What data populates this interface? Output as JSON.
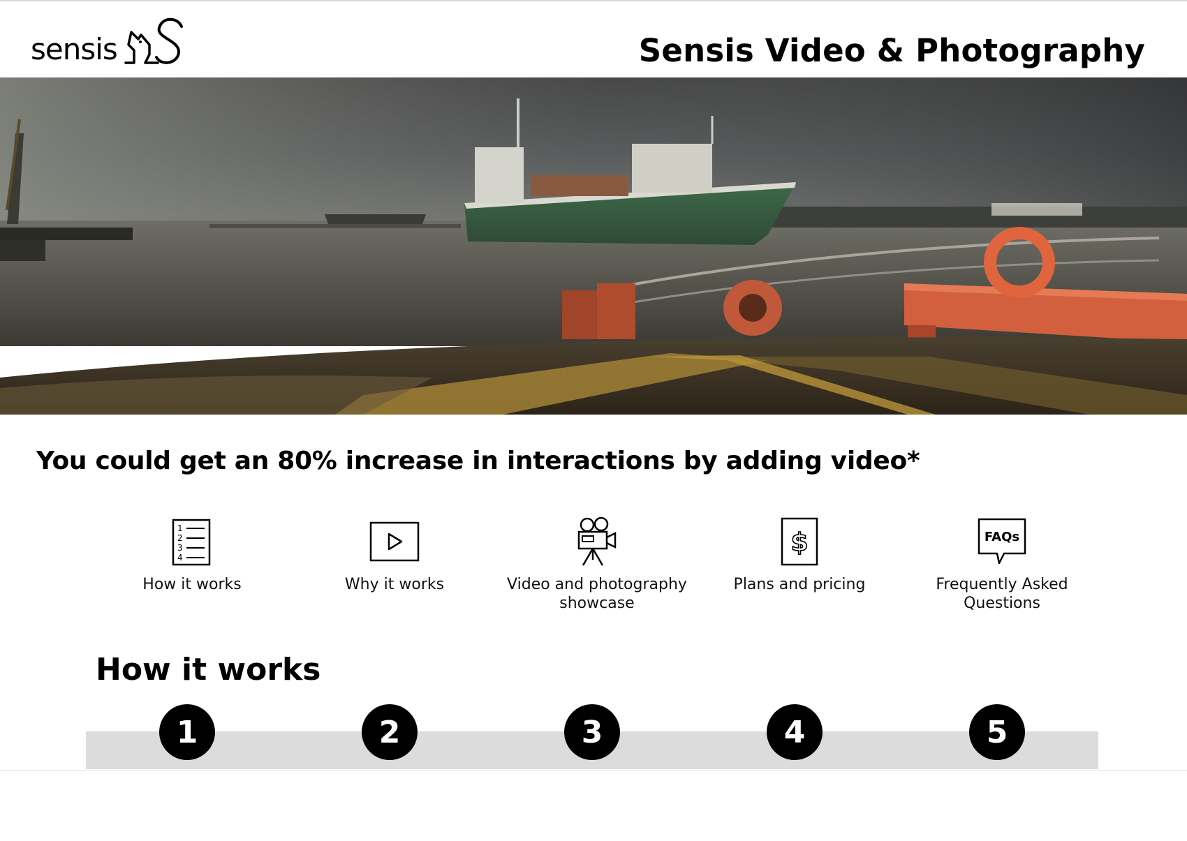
{
  "header": {
    "logo_text": "sensis",
    "title": "Sensis Video & Photography"
  },
  "hero": {
    "image": "harbour-cargo-ship-photo"
  },
  "headline": "You could get an 80% increase in interactions by adding video*",
  "quicklinks": [
    {
      "label": "How it works",
      "icon": "numbered-list-icon"
    },
    {
      "label": "Why it works",
      "icon": "play-icon"
    },
    {
      "label": "Video and photography showcase",
      "icon": "film-camera-icon"
    },
    {
      "label": "Plans and pricing",
      "icon": "dollar-icon"
    },
    {
      "label": "Frequently Asked Questions",
      "icon": "faq-bubble-icon",
      "icon_text": "FAQs"
    }
  ],
  "how_it_works": {
    "title": "How it works",
    "steps": [
      "1",
      "2",
      "3",
      "4",
      "5"
    ]
  },
  "colors": {
    "steps_bar": "#dcdcdc",
    "step_circle": "#000000",
    "text": "#000000"
  }
}
